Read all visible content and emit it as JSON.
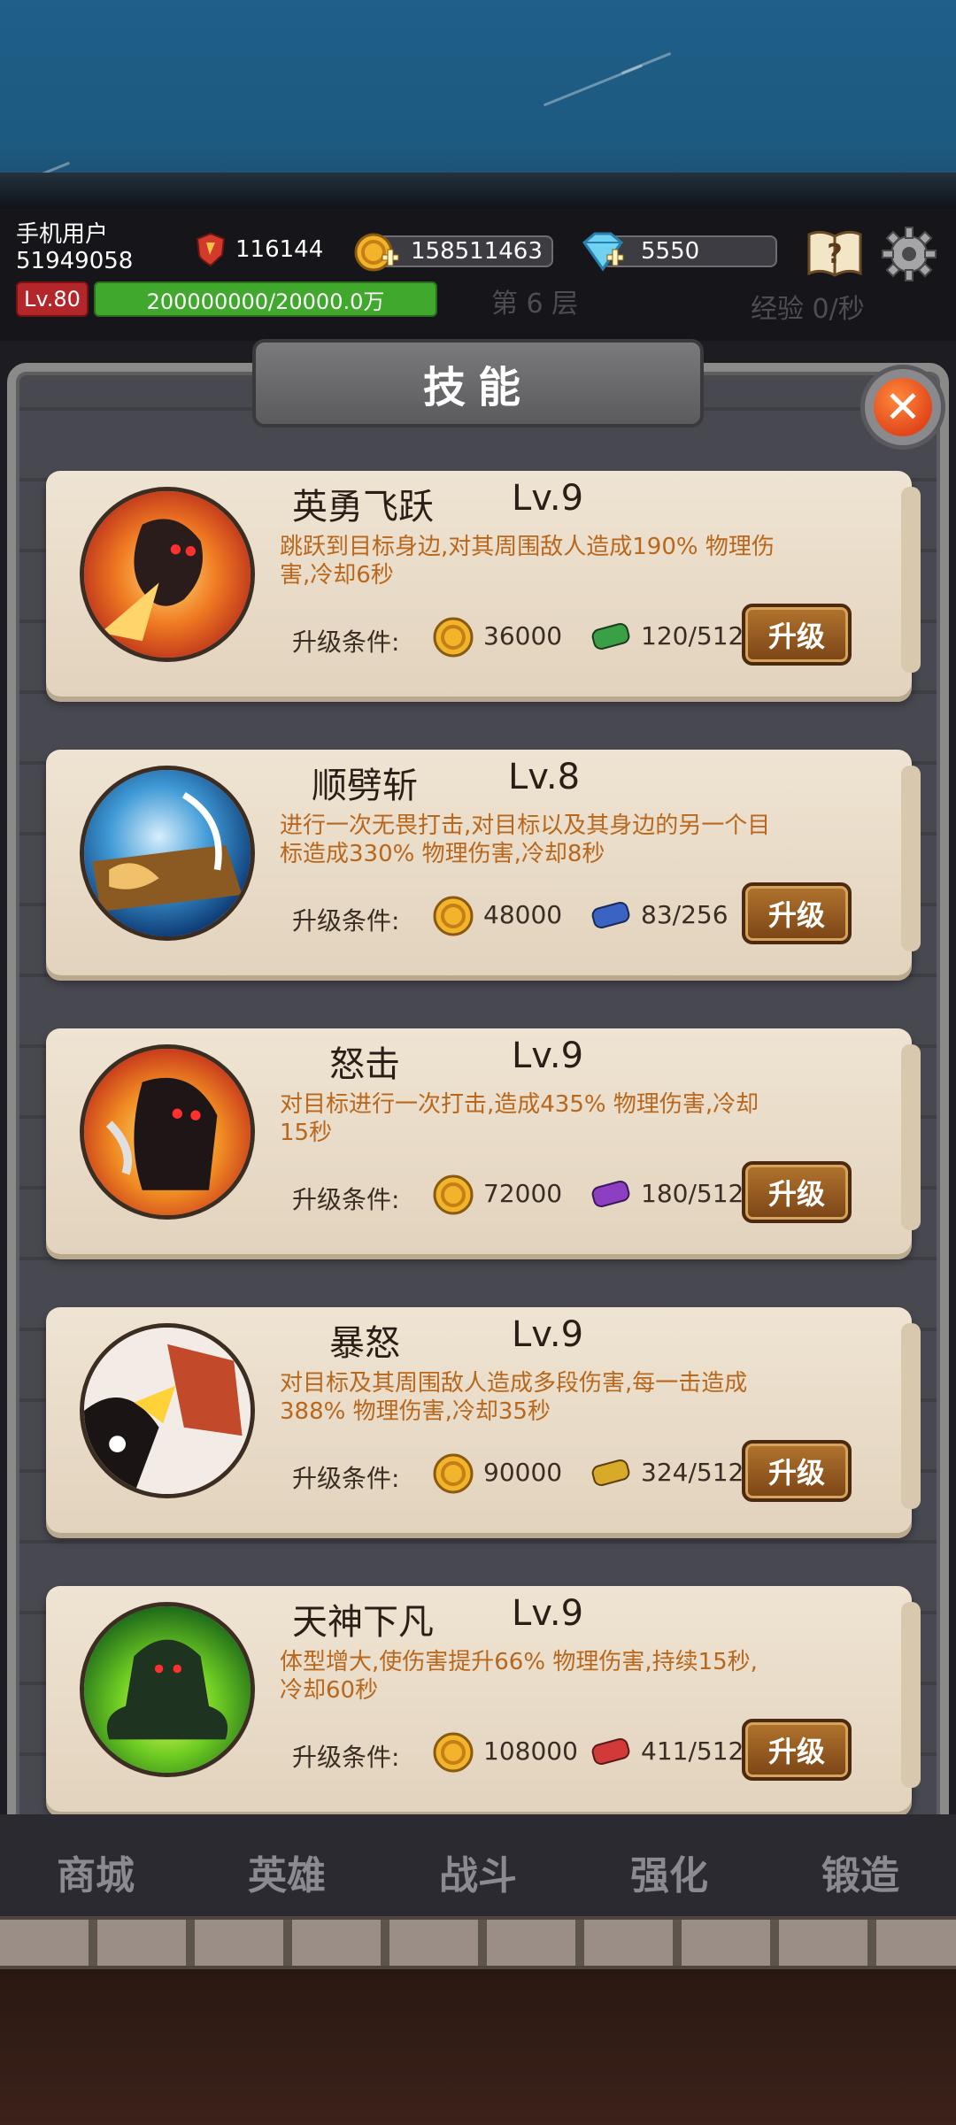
{
  "user": {
    "name": "手机用户",
    "id": "51949058",
    "level": "Lv.80",
    "xp": "200000000/20000.0万"
  },
  "resources": {
    "power": "116144",
    "gold": "158511463",
    "diamonds": "5550"
  },
  "background_text": {
    "floor": "第 6 层",
    "exp_rate": "经验 0/秒"
  },
  "panel": {
    "title": "技能"
  },
  "skills": [
    {
      "name": "英勇飞跃",
      "level": "Lv.9",
      "description": "跳跃到目标身边,对其周围敌人造成190% 物理伤害,冷却6秒",
      "req_label": "升级条件:",
      "gold_cost": "36000",
      "scroll_progress": "120/512",
      "scroll_color": "#3aa046",
      "button": "升级"
    },
    {
      "name": "顺劈斩",
      "level": "Lv.8",
      "description": "进行一次无畏打击,对目标以及其身边的另一个目标造成330% 物理伤害,冷却8秒",
      "req_label": "升级条件:",
      "gold_cost": "48000",
      "scroll_progress": "83/256",
      "scroll_color": "#3b63c4",
      "button": "升级"
    },
    {
      "name": "怒击",
      "level": "Lv.9",
      "description": "对目标进行一次打击,造成435% 物理伤害,冷却15秒",
      "req_label": "升级条件:",
      "gold_cost": "72000",
      "scroll_progress": "180/512",
      "scroll_color": "#8c3fc0",
      "button": "升级"
    },
    {
      "name": "暴怒",
      "level": "Lv.9",
      "description": "对目标及其周围敌人造成多段伤害,每一击造成 388% 物理伤害,冷却35秒",
      "req_label": "升级条件:",
      "gold_cost": "90000",
      "scroll_progress": "324/512",
      "scroll_color": "#d9a92a",
      "button": "升级"
    },
    {
      "name": "天神下凡",
      "level": "Lv.9",
      "description": "体型增大,使伤害提升66% 物理伤害,持续15秒,冷却60秒",
      "req_label": "升级条件:",
      "gold_cost": "108000",
      "scroll_progress": "411/512",
      "scroll_color": "#d23a3a",
      "button": "升级"
    }
  ],
  "nav": {
    "tabs": [
      "商城",
      "英雄",
      "战斗",
      "强化",
      "锻造"
    ]
  }
}
